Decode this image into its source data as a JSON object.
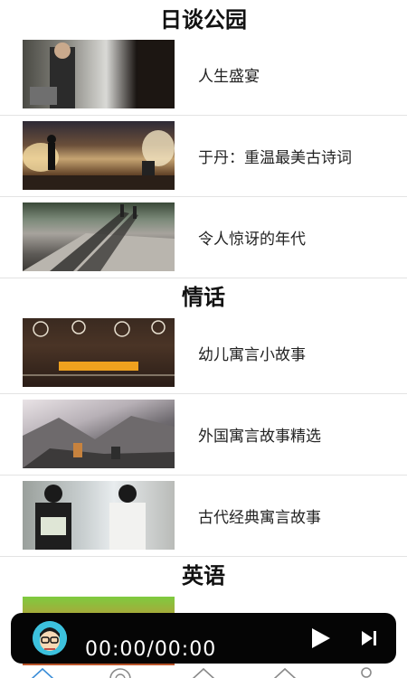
{
  "sections": [
    {
      "title": "日谈公园"
    },
    {
      "title": "情话"
    },
    {
      "title": "英语"
    }
  ],
  "items": [
    {
      "title": "人生盛宴"
    },
    {
      "title": "于丹：重温最美古诗词"
    },
    {
      "title": "令人惊讶的年代"
    },
    {
      "title": "幼儿寓言小故事"
    },
    {
      "title": "外国寓言故事精选"
    },
    {
      "title": "古代经典寓言故事"
    }
  ],
  "player": {
    "time": "00:00/00:00",
    "play_icon": "play-icon",
    "next_icon": "skip-next-icon"
  },
  "colors": {
    "player_bg": "#050505",
    "accent": "#3cc1dd",
    "divider": "#e3e3e3"
  },
  "tabbar": {
    "icons": [
      "home-icon",
      "disc-icon",
      "shop-icon",
      "bookmark-icon",
      "profile-icon"
    ]
  }
}
